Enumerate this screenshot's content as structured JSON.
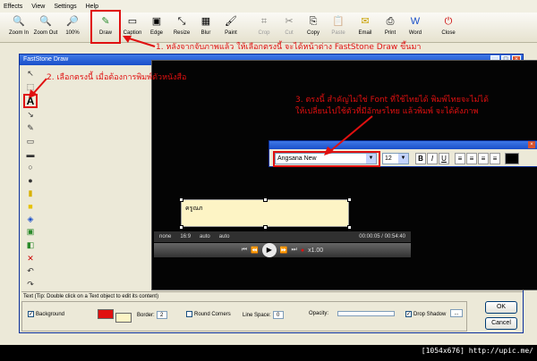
{
  "menubar": {
    "items": [
      "Effects",
      "View",
      "Settings",
      "Help"
    ]
  },
  "toolbar": {
    "buttons": [
      {
        "label": "Zoom In",
        "icon": "zoom-in-icon",
        "disabled": false
      },
      {
        "label": "Zoom Out",
        "icon": "zoom-out-icon",
        "disabled": false
      },
      {
        "label": "100%",
        "icon": "zoom-100-icon",
        "disabled": false
      },
      {
        "label": "Draw",
        "icon": "draw-icon",
        "disabled": false
      },
      {
        "label": "Caption",
        "icon": "caption-icon",
        "disabled": false
      },
      {
        "label": "Edge",
        "icon": "edge-icon",
        "disabled": false
      },
      {
        "label": "Resize",
        "icon": "resize-icon",
        "disabled": false
      },
      {
        "label": "Blur",
        "icon": "blur-icon",
        "disabled": false
      },
      {
        "label": "Paint",
        "icon": "paint-icon",
        "disabled": false
      },
      {
        "label": "Crop",
        "icon": "crop-icon",
        "disabled": true
      },
      {
        "label": "Cut",
        "icon": "cut-icon",
        "disabled": true
      },
      {
        "label": "Copy",
        "icon": "copy-icon",
        "disabled": false
      },
      {
        "label": "Paste",
        "icon": "paste-icon",
        "disabled": true
      },
      {
        "label": "Email",
        "icon": "email-icon",
        "disabled": false
      },
      {
        "label": "Print",
        "icon": "print-icon",
        "disabled": false
      },
      {
        "label": "Word",
        "icon": "word-icon",
        "disabled": false
      },
      {
        "label": "Close",
        "icon": "close-icon",
        "disabled": false
      }
    ]
  },
  "annotations": {
    "note1": "1. หลังจากจับภาพแล้ว ให้เลือกตรงนี้ จะได้หน้าต่าง FastStone Draw ขึ้นมา",
    "note2": "2. เลือกตรงนี้ เมื่อต้องการพิมพ์ตัวหนังสือ",
    "note3_line1": "3. ตรงนี้ สำคัญไม่ใช่ Font ที่ใช้ไทยได้ พิมพ์ไทยจะไม่ได้",
    "note3_line2": "ให้เปลี่ยนไปใช้ตัวที่มีอักษรไทย แล้วพิมพ์ จะได้ดังภาพ"
  },
  "dialog": {
    "title": "FastStone Draw",
    "caption_text": "ครูณภ",
    "player": {
      "time": "00:00:05 / 00:54:40",
      "zoom_label": "x1.00",
      "aspect": "16:9",
      "audio": "none",
      "auto1": "auto",
      "auto2": "auto"
    },
    "font_bar": {
      "font_name": "Angsana New",
      "font_size": "12",
      "bold_label": "B",
      "italic_label": "I",
      "underline_label": "U"
    },
    "status_tip": "Text (Tip: Double click on a Text object to edit its content)",
    "options": {
      "background_label": "Background",
      "border_label": "Border:",
      "border_value": "2",
      "round_corners_label": "Round Corners",
      "line_space_label": "Line Space:",
      "line_space_value": "0",
      "opacity_label": "Opacity:",
      "drop_shadow_label": "Drop Shadow",
      "more_label": "..."
    },
    "ok_label": "OK",
    "cancel_label": "Cancel"
  },
  "watermark": "[1054x676] http://upic.me/",
  "colors": {
    "annotation_red": "#e01010",
    "title_blue": "#1a4fc9"
  }
}
